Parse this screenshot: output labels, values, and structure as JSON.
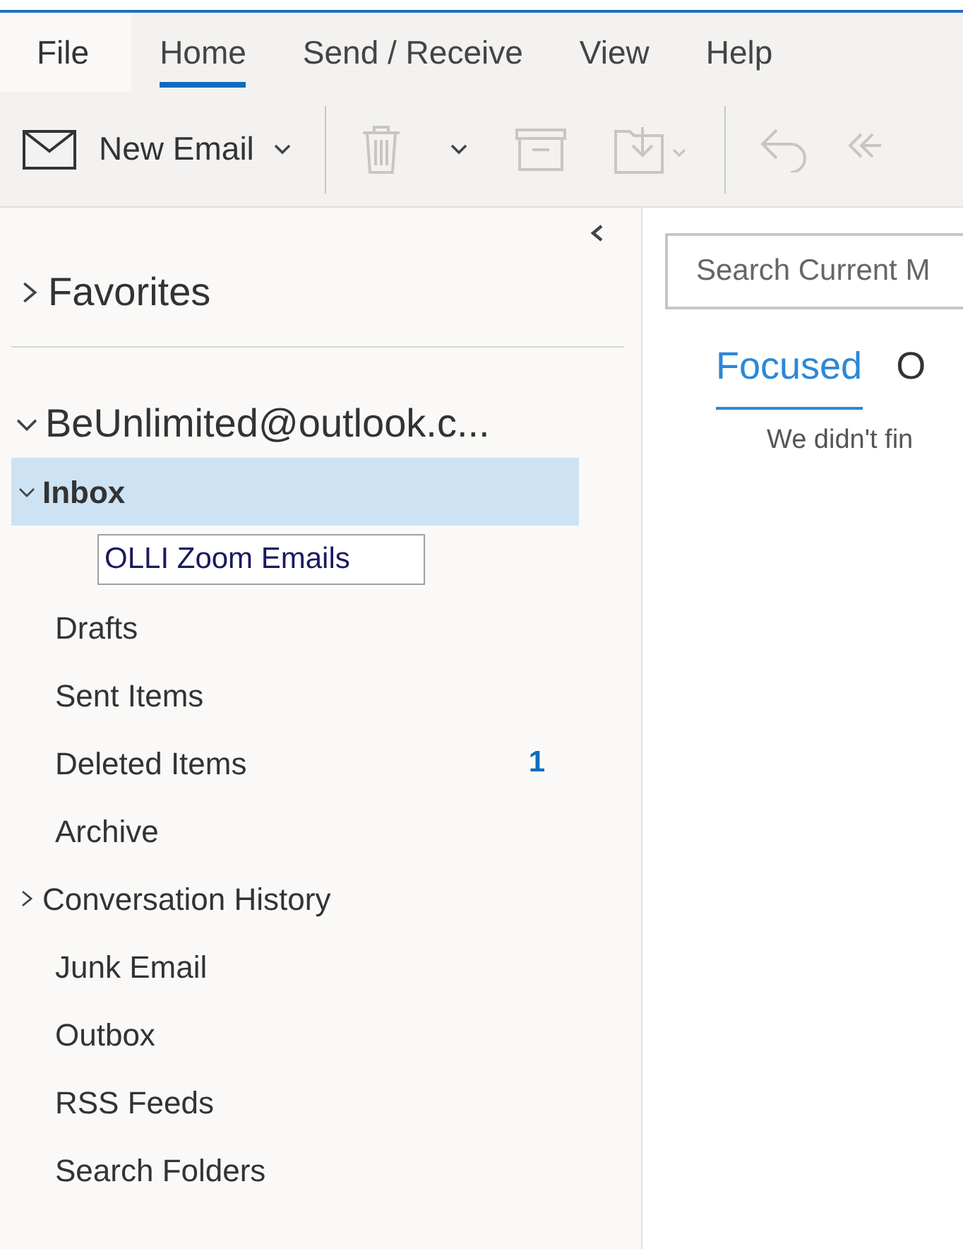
{
  "menu_tabs": [
    {
      "label": "File",
      "kind": "file",
      "selected": false
    },
    {
      "label": "Home",
      "kind": "tab",
      "selected": true
    },
    {
      "label": "Send / Receive",
      "kind": "tab",
      "selected": false
    },
    {
      "label": "View",
      "kind": "tab",
      "selected": false
    },
    {
      "label": "Help",
      "kind": "tab",
      "selected": false
    }
  ],
  "ribbon": {
    "new_email": "New Email"
  },
  "folder_pane": {
    "favorites": {
      "label": "Favorites",
      "expanded": false
    },
    "account": {
      "label": "BeUnlimited@outlook.c...",
      "expanded": true,
      "folders": [
        {
          "label": "Inbox",
          "selected": true,
          "expanded": true,
          "children": [
            {
              "kind": "rename",
              "value": "OLLI Zoom Emails"
            }
          ]
        },
        {
          "label": "Drafts",
          "selected": false
        },
        {
          "label": "Sent Items",
          "selected": false
        },
        {
          "label": "Deleted Items",
          "selected": false,
          "count": "1"
        },
        {
          "label": "Archive",
          "selected": false
        },
        {
          "label": "Conversation History",
          "selected": false,
          "expanded": false
        },
        {
          "label": "Junk Email",
          "selected": false
        },
        {
          "label": "Outbox",
          "selected": false
        },
        {
          "label": "RSS Feeds",
          "selected": false
        },
        {
          "label": "Search Folders",
          "selected": false
        }
      ]
    }
  },
  "message_list": {
    "search": {
      "placeholder": "Search Current M"
    },
    "tabs": [
      {
        "label": "Focused",
        "selected": true
      },
      {
        "label": "O",
        "selected": false
      }
    ],
    "empty_message": "We didn't fin"
  }
}
